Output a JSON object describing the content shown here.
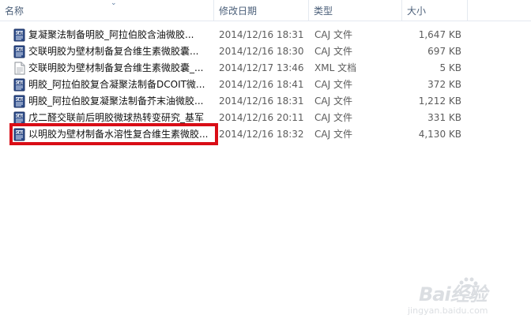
{
  "columns": {
    "name": "名称",
    "date": "修改日期",
    "type": "类型",
    "size": "大小"
  },
  "files": [
    {
      "name": "复凝聚法制备明胶_阿拉伯胶含油微胶...",
      "date": "2014/12/16 18:31",
      "type": "CAJ 文件",
      "size": "1,647 KB",
      "icon": "caj-file-icon"
    },
    {
      "name": "交联明胶为壁材制备复合维生素微胶囊...",
      "date": "2014/12/16 18:30",
      "type": "CAJ 文件",
      "size": "697 KB",
      "icon": "caj-file-icon"
    },
    {
      "name": "交联明胶为壁材制备复合维生素微胶囊_...",
      "date": "2014/12/17 13:46",
      "type": "XML 文档",
      "size": "5 KB",
      "icon": "xml-file-icon"
    },
    {
      "name": "明胶_阿拉伯胶复合凝聚法制备DCOIT微...",
      "date": "2014/12/16 18:41",
      "type": "CAJ 文件",
      "size": "372 KB",
      "icon": "caj-file-icon"
    },
    {
      "name": "明胶_阿拉伯胶复凝聚法制备芥末油微胶...",
      "date": "2014/12/16 18:31",
      "type": "CAJ 文件",
      "size": "1,212 KB",
      "icon": "caj-file-icon"
    },
    {
      "name": "戊二醛交联前后明胶微球热转变研究_基军",
      "date": "2014/12/16 20:11",
      "type": "CAJ 文件",
      "size": "331 KB",
      "icon": "caj-file-icon"
    },
    {
      "name": "以明胶为壁材制备水溶性复合维生素微胶...",
      "date": "2014/12/16 18:32",
      "type": "CAJ 文件",
      "size": "4,130 KB",
      "icon": "caj-file-icon"
    }
  ],
  "highlight_color": "#d90d16",
  "watermark": {
    "brand": "Bai经验",
    "url": "jingyan.baidu.com"
  }
}
